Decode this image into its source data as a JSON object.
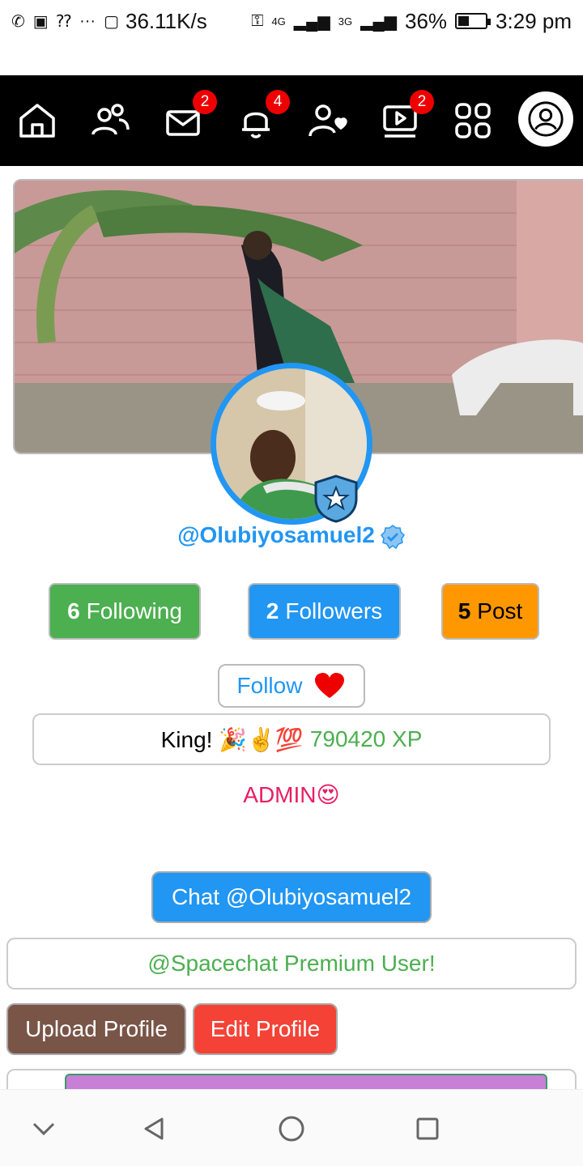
{
  "status_bar": {
    "speed": "36.11K/s",
    "net1": "4G",
    "net2": "3G",
    "battery": "36%",
    "time": "3:29 pm"
  },
  "nav": {
    "messages_badge": "2",
    "notifications_badge": "4",
    "videos_badge": "2"
  },
  "profile": {
    "username": "@Olubiyosamuel2",
    "following_count": "6",
    "following_label": "Following",
    "followers_count": "2",
    "followers_label": "Followers",
    "posts_count": "5",
    "posts_label": "Post",
    "follow_label": "Follow",
    "bio_text": "King! 🎉✌️💯",
    "xp_text": "790420 XP",
    "role": "ADMIN😍",
    "chat_label": "Chat @Olubiyosamuel2",
    "premium_label": "@Spacechat Premium User!",
    "upload_label": "Upload Profile",
    "edit_label": "Edit Profile"
  },
  "colors": {
    "following_bg": "#4caf50",
    "followers_bg": "#2196f3",
    "posts_bg": "#ff9800",
    "chat_bg": "#2196f3",
    "upload_bg": "#795548",
    "edit_bg": "#f44336",
    "role_color": "#e91e63",
    "xp_color": "#4caf50"
  }
}
